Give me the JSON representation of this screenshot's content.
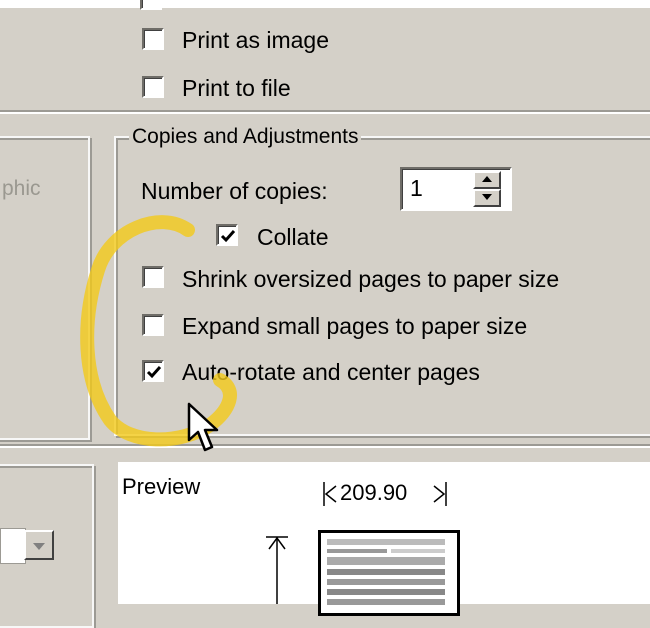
{
  "options": {
    "print_as_image": {
      "label": "Print as image",
      "checked": false
    },
    "print_to_file": {
      "label": "Print to file",
      "checked": false
    }
  },
  "left_panel": {
    "partial_text": "phic"
  },
  "copies_group": {
    "legend": "Copies and Adjustments",
    "number_of_copies_label": "Number of copies:",
    "number_of_copies_value": "1",
    "collate": {
      "label": "Collate",
      "checked": true
    },
    "shrink": {
      "label": "Shrink oversized pages to paper size",
      "checked": false
    },
    "expand": {
      "label": "Expand small pages to paper size",
      "checked": false
    },
    "auto_rotate": {
      "label": "Auto-rotate and center pages",
      "checked": true
    }
  },
  "preview": {
    "label": "Preview",
    "width_dimension": "209.90"
  },
  "colors": {
    "dialog_bg": "#d4d0c8",
    "highlight_annotation": "#f2c919"
  },
  "icons": [
    "checkbox-check-icon",
    "spin-up-icon",
    "spin-down-icon",
    "dropdown-arrow-icon",
    "mouse-cursor-icon",
    "dimension-arrow-icon"
  ]
}
